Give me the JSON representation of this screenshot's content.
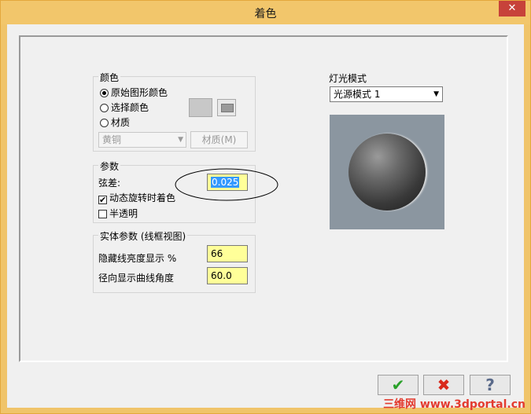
{
  "window": {
    "title": "着色",
    "close_glyph": "✕"
  },
  "color_group": {
    "label": "颜色",
    "options": [
      {
        "label": "原始图形颜色",
        "selected": true
      },
      {
        "label": "选择颜色",
        "selected": false
      },
      {
        "label": "材质",
        "selected": false
      }
    ],
    "material_select": "黄铜",
    "material_button": "材质(M)"
  },
  "params_group": {
    "label": "参数",
    "chord_label": "弦差:",
    "chord_value": "0.025",
    "dynamic_label": "动态旋转时着色",
    "dynamic_checked": true,
    "translucent_label": "半透明",
    "translucent_checked": false
  },
  "solid_group": {
    "label": "实体参数 (线框视图)",
    "hidden_label": "隐藏线亮度显示 %",
    "hidden_value": "66",
    "radial_label": "径向显示曲线角度",
    "radial_value": "60.0"
  },
  "light": {
    "label": "灯光模式",
    "selected": "光源模式 1"
  },
  "buttons": {
    "ok_glyph": "✔",
    "cancel_glyph": "✖",
    "help_glyph": "?"
  },
  "colors": {
    "ok": "#2aa12a",
    "cancel": "#d92a1c",
    "help": "#5a6a8a"
  },
  "watermark": "三维网 www.3dportal.cn"
}
